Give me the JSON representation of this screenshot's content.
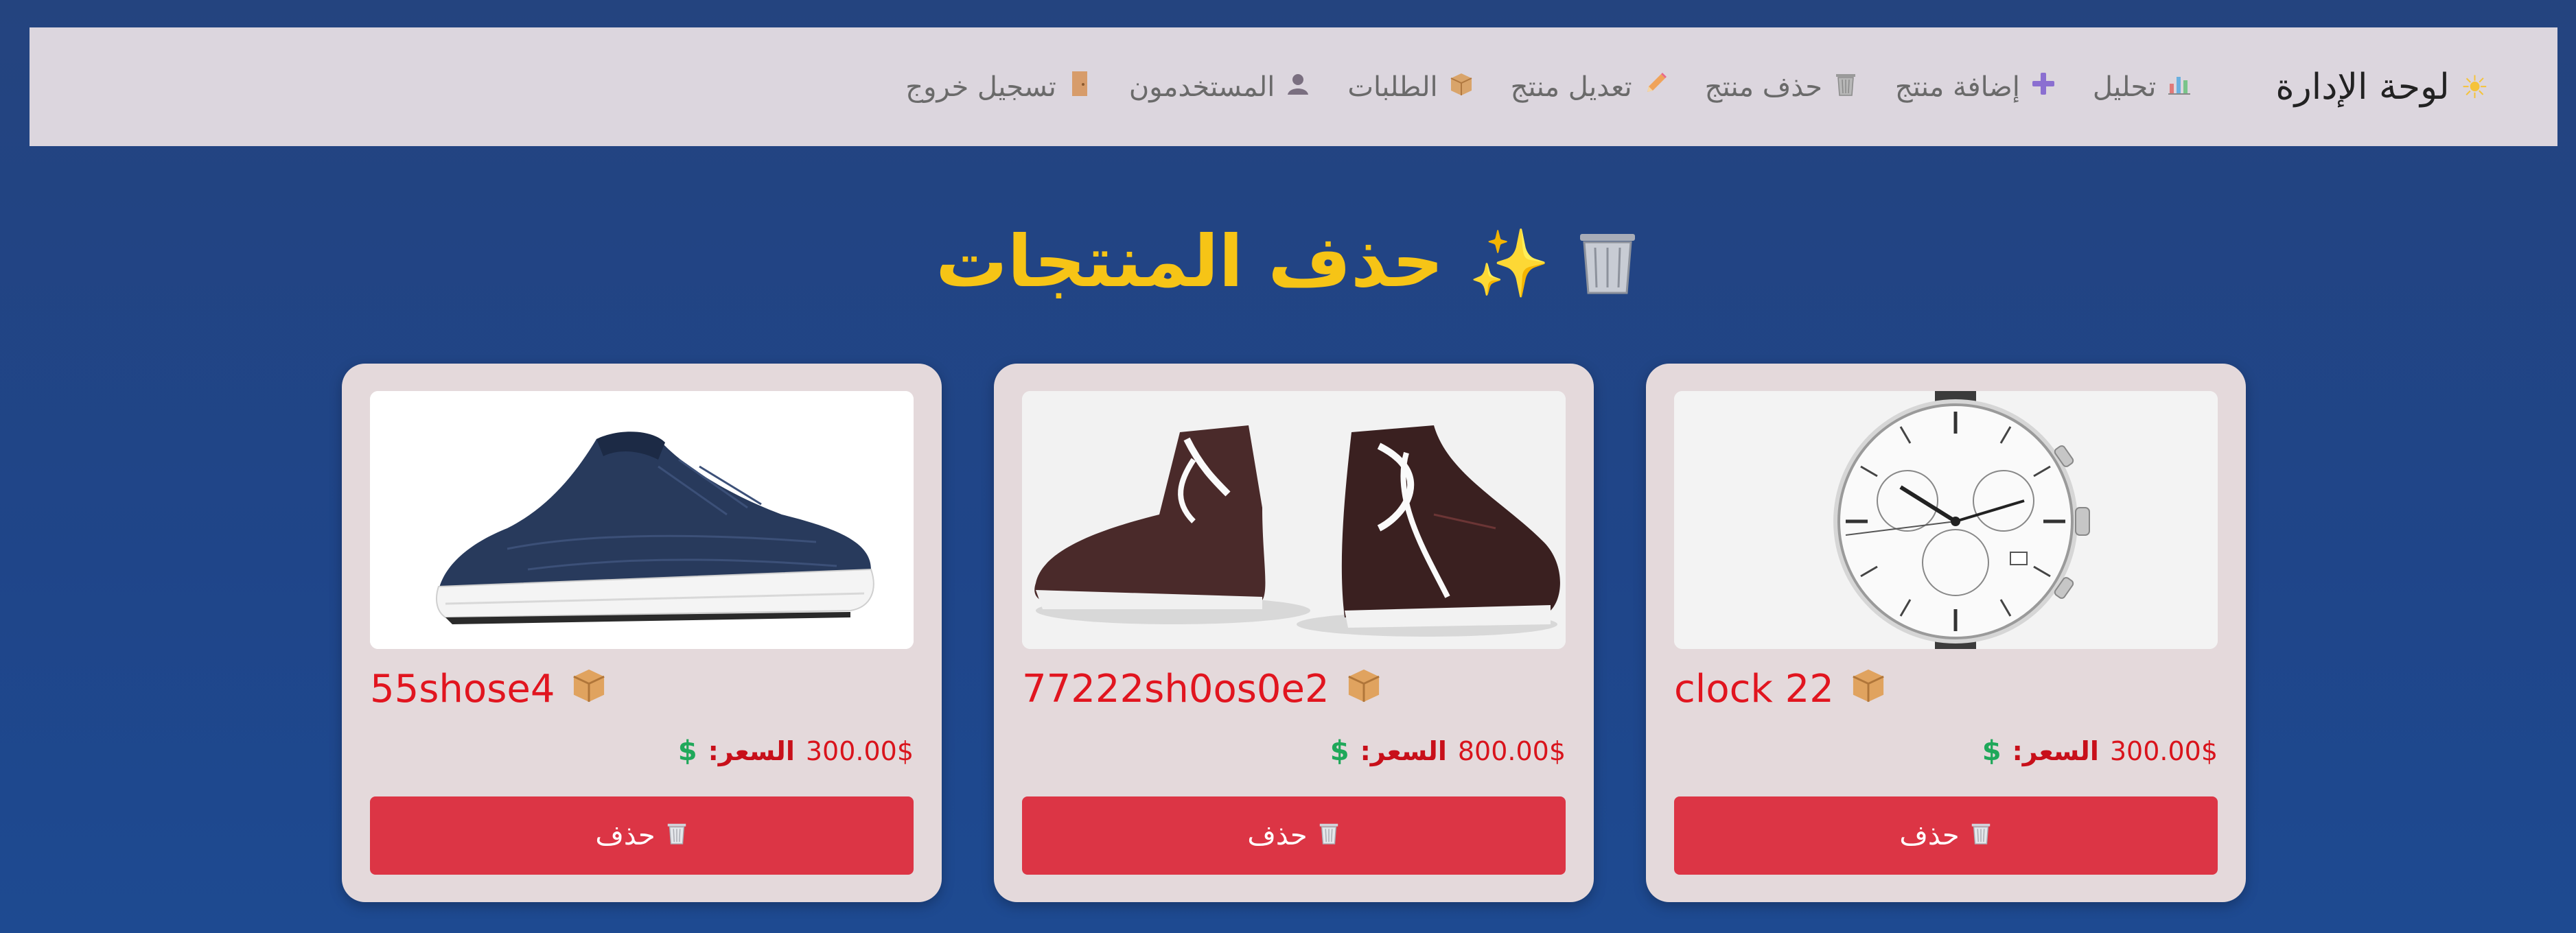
{
  "navbar": {
    "brand_icon": "sun-icon",
    "brand_label": "لوحة الإدارة",
    "links": [
      {
        "icon": "chart-icon",
        "glyph": "📊",
        "label": "تحليل"
      },
      {
        "icon": "plus-icon",
        "glyph": "➕",
        "label": "إضافة منتج"
      },
      {
        "icon": "trash-icon",
        "glyph": "🗑",
        "label": "حذف منتج"
      },
      {
        "icon": "pencil-icon",
        "glyph": "✏",
        "label": "تعديل منتج"
      },
      {
        "icon": "box-icon",
        "glyph": "📦",
        "label": "الطلبات"
      },
      {
        "icon": "user-icon",
        "glyph": "👤",
        "label": "المستخدمون"
      },
      {
        "icon": "door-icon",
        "glyph": "🚪",
        "label": "تسجيل خروج"
      }
    ]
  },
  "page": {
    "title": "حذف المنتجات"
  },
  "products": [
    {
      "name": "clock 22",
      "price_label": "السعر:",
      "price": "300.00$",
      "delete_label": "حذف",
      "image": "watch"
    },
    {
      "name": "77222sh0os0e2",
      "price_label": "السعر:",
      "price": "800.00$",
      "delete_label": "حذف",
      "image": "boots"
    },
    {
      "name": "55shose4",
      "price_label": "السعر:",
      "price": "300.00$",
      "delete_label": "حذف",
      "image": "sneaker"
    }
  ],
  "colors": {
    "background": "#22447f",
    "navbar": "#dcd6de",
    "title": "#f6c416",
    "card": "#e4d9db",
    "product_name": "#e1151f",
    "delete_button": "#dc3545",
    "dollar": "#1fa85a"
  }
}
